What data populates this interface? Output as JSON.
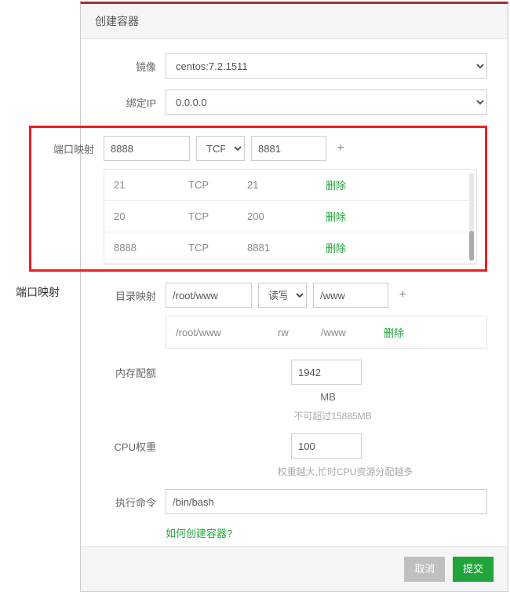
{
  "sideLabel": "端口映射",
  "dialogTitle": "创建容器",
  "labels": {
    "image": "镜像",
    "bindIp": "绑定IP",
    "portMap": "端口映射",
    "dirMap": "目录映射",
    "memQuota": "内存配额",
    "cpuWeight": "CPU权重",
    "execCmd": "执行命令"
  },
  "image": {
    "value": "centos:7.2.1511"
  },
  "bindIp": {
    "value": "0.0.0.0"
  },
  "portMap": {
    "input1": "8888",
    "proto": "TCP",
    "input2": "8881",
    "plus": "+",
    "rows": [
      {
        "a": "21",
        "b": "TCP",
        "c": "21",
        "del": "删除"
      },
      {
        "a": "20",
        "b": "TCP",
        "c": "200",
        "del": "删除"
      },
      {
        "a": "8888",
        "b": "TCP",
        "c": "8881",
        "del": "删除"
      }
    ]
  },
  "dirMap": {
    "input1": "/root/www",
    "mode": "读写",
    "input2": "/www",
    "plus": "+",
    "rows": [
      {
        "a": "/root/www",
        "b": "rw",
        "c": "/www",
        "del": "删除"
      }
    ]
  },
  "mem": {
    "value": "1942",
    "unit": "MB",
    "hint": "不可超过15885MB"
  },
  "cpu": {
    "value": "100",
    "hint": "权重越大,忙时CPU资源分配越多"
  },
  "cmd": {
    "value": "/bin/bash"
  },
  "helpLink": "如何创建容器?",
  "footer": {
    "cancel": "取消",
    "submit": "提交"
  }
}
